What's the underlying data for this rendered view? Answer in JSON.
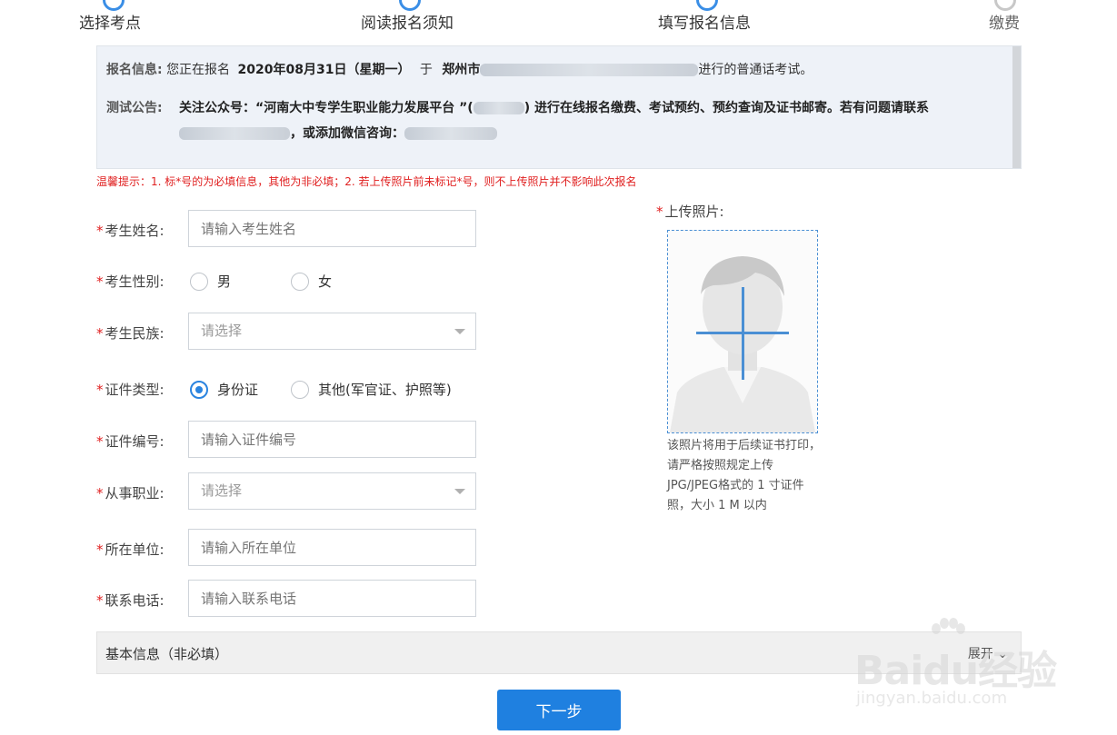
{
  "steps": [
    {
      "label": "选择考点",
      "state": "done"
    },
    {
      "label": "阅读报名须知",
      "state": "done"
    },
    {
      "label": "填写报名信息",
      "state": "current"
    },
    {
      "label": "缴费",
      "state": "todo"
    }
  ],
  "info": {
    "registration_label": "报名信息:",
    "registration_prefix": "您正在报名",
    "date": "2020年08月31日（星期一）",
    "at": "于",
    "city": "郑州市",
    "suffix": "进行的普通话考试。",
    "notice_label": "测试公告:",
    "notice_part1": "关注公众号：“河南大中专学生职业能力发展平台 ”(",
    "notice_part2": ") 进行在线报名缴费、考试预约、预约查询及证书邮寄。若有问题请联系",
    "notice_part3": "，或添加微信咨询："
  },
  "tip": "温馨提示：1. 标*号的为必填信息，其他为非必填；2. 若上传照片前未标记*号，则不上传照片并不影响此次报名",
  "form": {
    "required_mark": "*",
    "name": {
      "label": "考生姓名:",
      "placeholder": "请输入考生姓名"
    },
    "gender": {
      "label": "考生性别:",
      "options": [
        "男",
        "女"
      ],
      "selected": null
    },
    "ethnicity": {
      "label": "考生民族:",
      "value": "请选择"
    },
    "id_type": {
      "label": "证件类型:",
      "options": [
        "身份证",
        "其他(军官证、护照等)"
      ],
      "selected": "身份证"
    },
    "id_number": {
      "label": "证件编号:",
      "placeholder": "请输入证件编号"
    },
    "occupation": {
      "label": "从事职业:",
      "value": "请选择"
    },
    "employer": {
      "label": "所在单位:",
      "placeholder": "请输入所在单位"
    },
    "phone": {
      "label": "联系电话:",
      "placeholder": "请输入联系电话"
    }
  },
  "photo": {
    "label": "上传照片:",
    "hint": "该照片将用于后续证书打印，请严格按照规定上传JPG/JPEG格式的 1 寸证件照，大小 1 M 以内"
  },
  "basic_info": {
    "title": "基本信息（非必填）",
    "toggle": "展开"
  },
  "next_button": "下一步",
  "watermark": {
    "brand": "Baidu经验",
    "url": "jingyan.baidu.com"
  },
  "colors": {
    "accent": "#1f80e0",
    "required": "#e02020",
    "panel_bg": "#eef2f8"
  }
}
